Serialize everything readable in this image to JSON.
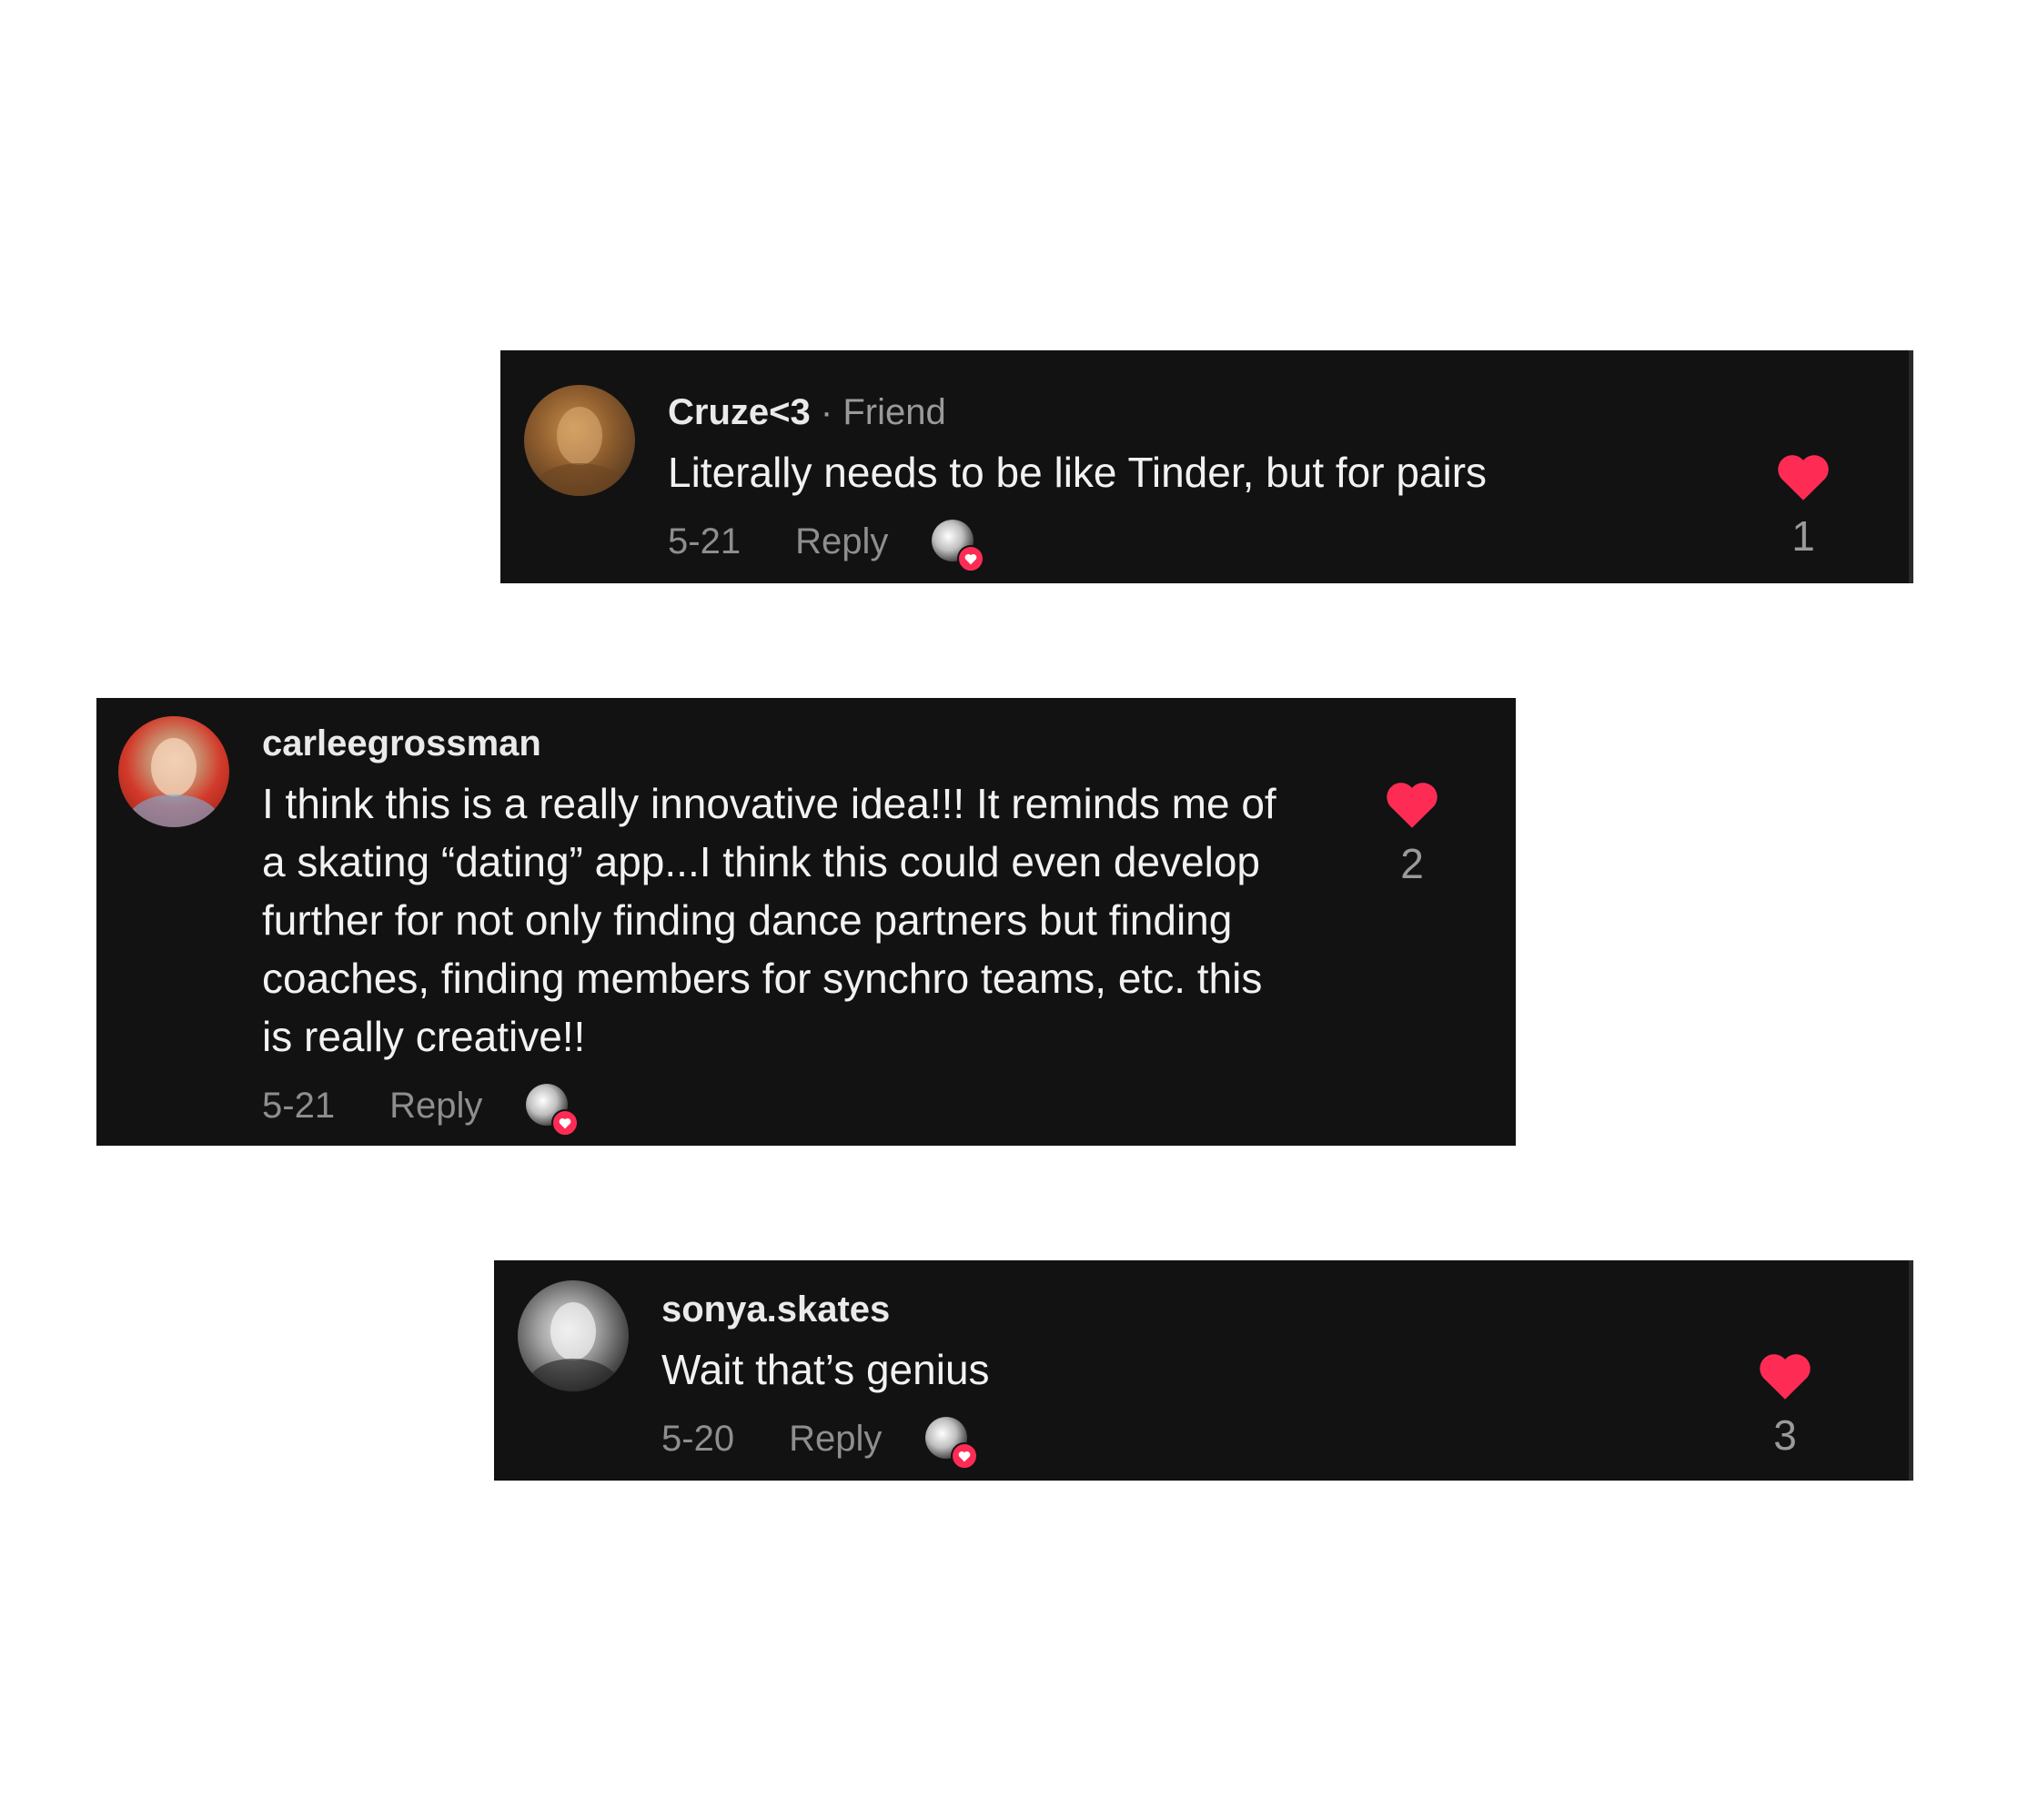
{
  "comments": [
    {
      "username": "Cruze<3",
      "separator": "·",
      "badge": "Friend",
      "text": "Literally needs to be like Tinder, but for pairs",
      "date": "5-21",
      "reply_label": "Reply",
      "like_count": "1",
      "avatar_icon": "profile-photo-icon"
    },
    {
      "username": "carleegrossman",
      "separator": "",
      "badge": "",
      "text": "I think this is a really innovative idea!!! It reminds me of a skating “dating” app...I think this could even develop further for not only finding dance partners but finding coaches, finding members for synchro teams, etc. this is really creative!!",
      "date": "5-21",
      "reply_label": "Reply",
      "like_count": "2",
      "avatar_icon": "profile-photo-icon"
    },
    {
      "username": "sonya.skates",
      "separator": "",
      "badge": "",
      "text": "Wait that’s genius",
      "date": "5-20",
      "reply_label": "Reply",
      "like_count": "3",
      "avatar_icon": "profile-photo-icon"
    }
  ],
  "colors": {
    "card_background": "#121212",
    "like_heart": "#fe2c55",
    "muted_text": "#8e8e8e",
    "primary_text": "#f2f2f2"
  }
}
